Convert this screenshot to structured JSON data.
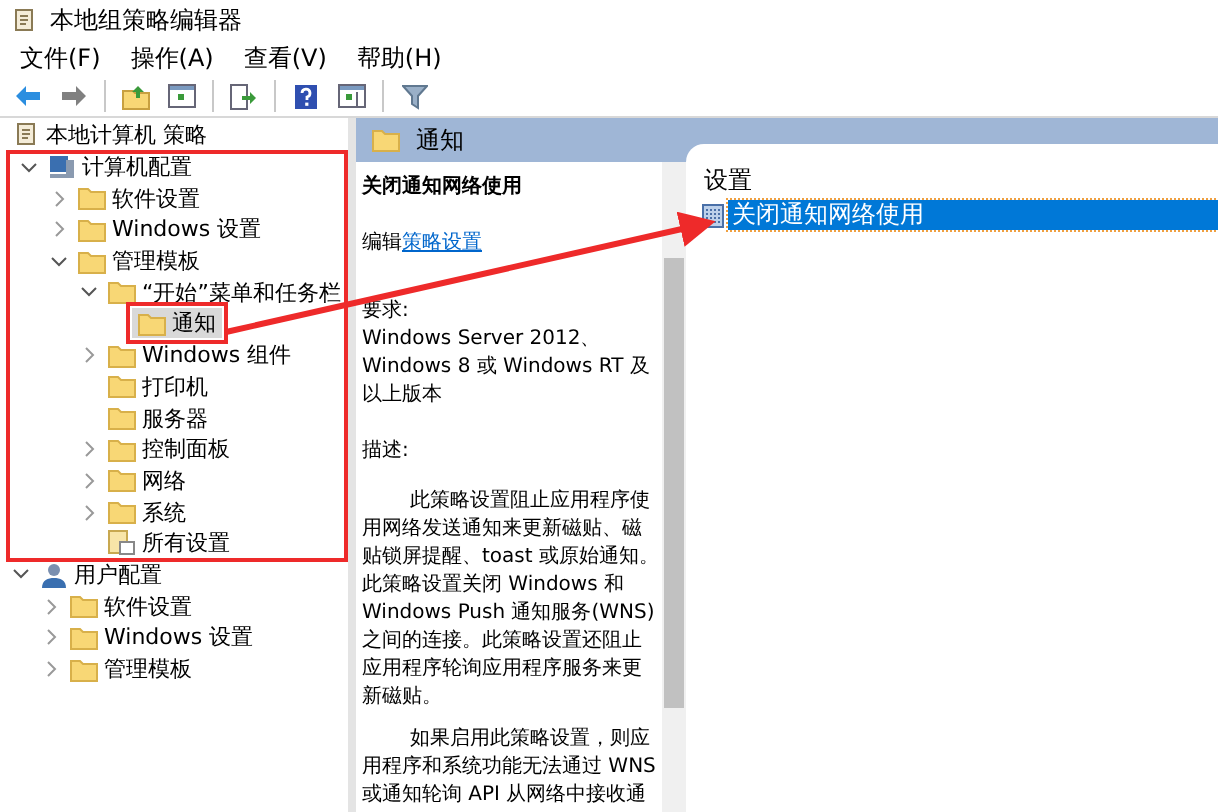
{
  "window": {
    "title": "本地组策略编辑器"
  },
  "menu": [
    {
      "label": "文件(F)"
    },
    {
      "label": "操作(A)"
    },
    {
      "label": "查看(V)"
    },
    {
      "label": "帮助(H)"
    }
  ],
  "toolbar": [
    {
      "kind": "back"
    },
    {
      "kind": "forward"
    },
    {
      "kind": "separator"
    },
    {
      "kind": "up"
    },
    {
      "kind": "tree"
    },
    {
      "kind": "separator"
    },
    {
      "kind": "export"
    },
    {
      "kind": "separator"
    },
    {
      "kind": "help"
    },
    {
      "kind": "pane"
    },
    {
      "kind": "separator"
    },
    {
      "kind": "filter"
    }
  ],
  "tree": [
    {
      "label": "本地计算机 策略",
      "kind": "policy",
      "selected": false,
      "highlighted": false,
      "children": [
        {
          "label": "计算机配置",
          "kind": "computer",
          "expanded": true,
          "selected": false,
          "highlighted": true,
          "children": [
            {
              "label": "软件设置",
              "kind": "folder",
              "expanded": false,
              "selected": false,
              "highlighted": false
            },
            {
              "label": "Windows 设置",
              "kind": "folder",
              "expanded": false,
              "selected": false,
              "highlighted": false
            },
            {
              "label": "管理模板",
              "kind": "folder",
              "expanded": true,
              "selected": false,
              "highlighted": false,
              "children": [
                {
                  "label": "“开始”菜单和任务栏",
                  "kind": "folder",
                  "expanded": true,
                  "selected": false,
                  "highlighted": false,
                  "children": [
                    {
                      "label": "通知",
                      "kind": "folder",
                      "selected": true,
                      "highlighted": true
                    }
                  ]
                },
                {
                  "label": "Windows 组件",
                  "kind": "folder",
                  "expanded": false,
                  "selected": false,
                  "highlighted": false
                },
                {
                  "label": "打印机",
                  "kind": "folder",
                  "selected": false,
                  "highlighted": false
                },
                {
                  "label": "服务器",
                  "kind": "folder",
                  "selected": false,
                  "highlighted": false
                },
                {
                  "label": "控制面板",
                  "kind": "folder",
                  "expanded": false,
                  "selected": false,
                  "highlighted": false
                },
                {
                  "label": "网络",
                  "kind": "folder",
                  "expanded": false,
                  "selected": false,
                  "highlighted": false
                },
                {
                  "label": "系统",
                  "kind": "folder",
                  "expanded": false,
                  "selected": false,
                  "highlighted": false
                },
                {
                  "label": "所有设置",
                  "kind": "all-settings",
                  "selected": false,
                  "highlighted": false
                }
              ]
            }
          ]
        },
        {
          "label": "用户配置",
          "kind": "user",
          "expanded": true,
          "selected": false,
          "highlighted": false,
          "children": [
            {
              "label": "软件设置",
              "kind": "folder",
              "expanded": false,
              "selected": false,
              "highlighted": false
            },
            {
              "label": "Windows 设置",
              "kind": "folder",
              "expanded": false,
              "selected": false,
              "highlighted": false
            },
            {
              "label": "管理模板",
              "kind": "folder",
              "expanded": false,
              "selected": false,
              "highlighted": false
            }
          ]
        }
      ]
    }
  ],
  "details": {
    "header": "通知",
    "policy_title": "关闭通知网络使用",
    "edit_prefix": "编辑",
    "edit_link": "策略设置",
    "requirements_label": "要求:",
    "requirements": "Windows Server 2012、Windows 8 或 Windows RT 及以上版本",
    "description_label": "描述:",
    "paragraphs": [
      "此策略设置阻止应用程序使用网络发送通知来更新磁贴、磁贴锁屏提醒、toast 或原始通知。此策略设置关闭 Windows 和 Windows Push 通知服务(WNS)之间的连接。此策略设置还阻止应用程序轮询应用程序服务来更新磁贴。",
      "如果启用此策略设置，则应用程序和系统功能无法通过 WNS 或通知轮询 API 从网络中接收通"
    ]
  },
  "settings": {
    "column": "设置",
    "rows": [
      {
        "label": "关闭通知网络使用",
        "selected": true
      }
    ]
  }
}
